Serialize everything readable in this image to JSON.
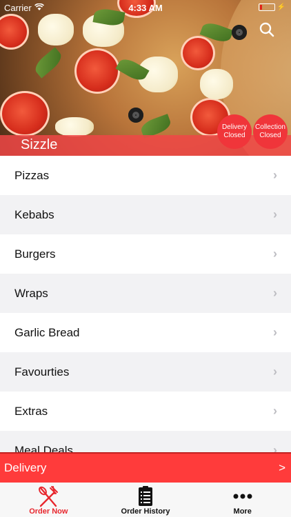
{
  "status_bar": {
    "carrier": "Carrier",
    "time": "4:33 AM"
  },
  "hero": {
    "brand_name": "Sizzle",
    "delivery_status": {
      "line1": "Delivery",
      "line2": "Closed"
    },
    "collection_status": {
      "line1": "Collection",
      "line2": "Closed"
    }
  },
  "categories": [
    {
      "label": "Pizzas"
    },
    {
      "label": "Kebabs"
    },
    {
      "label": "Burgers"
    },
    {
      "label": "Wraps"
    },
    {
      "label": "Garlic Bread"
    },
    {
      "label": "Favourties"
    },
    {
      "label": "Extras"
    },
    {
      "label": "Meal Deals"
    }
  ],
  "delivery_bar": {
    "label": "Delivery",
    "arrow": ">"
  },
  "tabbar": {
    "items": [
      {
        "label": "Order Now",
        "icon": "fork-knife-icon"
      },
      {
        "label": "Order History",
        "icon": "receipt-icon"
      },
      {
        "label": "More",
        "icon": "more-dots-icon"
      }
    ]
  },
  "colors": {
    "accent": "#ff3b3b",
    "active_tab": "#e8262d"
  }
}
